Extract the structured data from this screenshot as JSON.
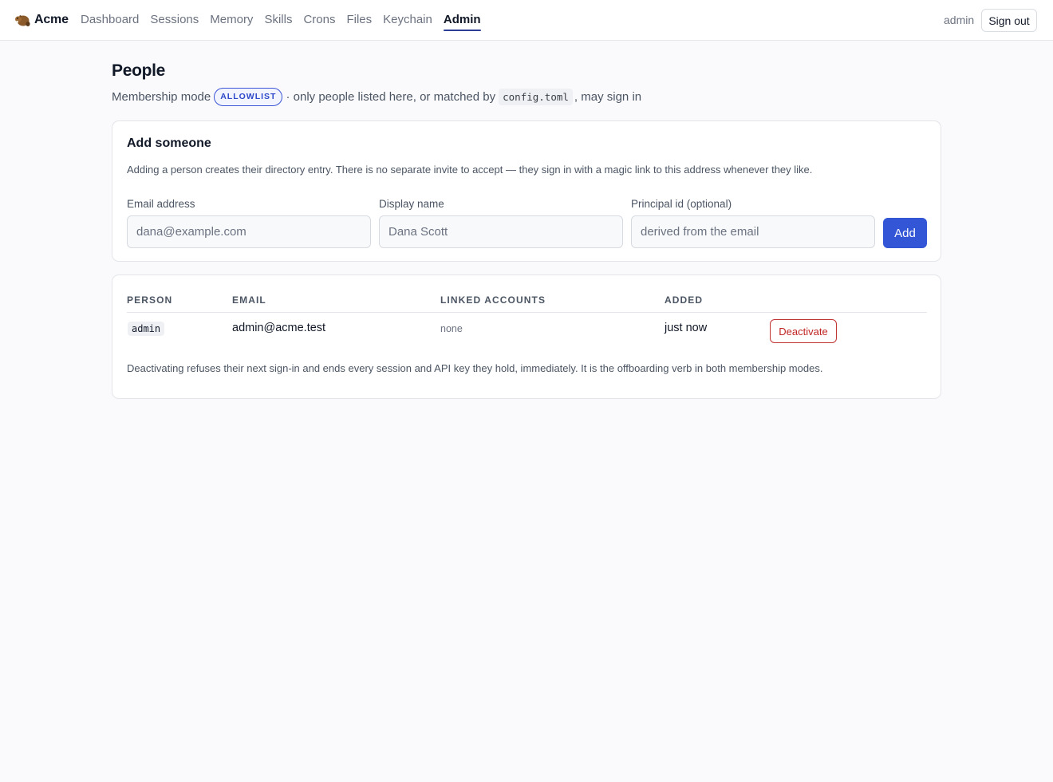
{
  "brand": {
    "name": "Acme",
    "logo_icon": "beaver-icon"
  },
  "nav": {
    "items": [
      {
        "label": "Dashboard",
        "active": false
      },
      {
        "label": "Sessions",
        "active": false
      },
      {
        "label": "Memory",
        "active": false
      },
      {
        "label": "Skills",
        "active": false
      },
      {
        "label": "Crons",
        "active": false
      },
      {
        "label": "Files",
        "active": false
      },
      {
        "label": "Keychain",
        "active": false
      },
      {
        "label": "Admin",
        "active": true
      }
    ],
    "accent_color": "#2c3e95"
  },
  "user": {
    "name": "admin",
    "signout_label": "Sign out"
  },
  "page": {
    "title": "People",
    "mode_prefix": "Membership mode",
    "mode_badge": "ALLOWLIST",
    "mode_middle": "· only people listed here, or matched by",
    "config_file": "config.toml",
    "mode_suffix": ", may sign in"
  },
  "add_card": {
    "title": "Add someone",
    "description": "Adding a person creates their directory entry. There is no separate invite to accept — they sign in with a magic link to this address whenever they like.",
    "fields": [
      {
        "label": "Email address",
        "placeholder": "dana@example.com",
        "value": ""
      },
      {
        "label": "Display name",
        "placeholder": "Dana Scott",
        "value": ""
      },
      {
        "label": "Principal id (optional)",
        "placeholder": "derived from the email",
        "value": ""
      }
    ],
    "add_label": "Add",
    "primary_color": "#3356d6"
  },
  "people_table": {
    "headers": [
      "Person",
      "Email",
      "Linked accounts",
      "Added"
    ],
    "rows": [
      {
        "person": "admin",
        "email": "admin@acme.test",
        "linked_accounts": "none",
        "added": "just now",
        "action_label": "Deactivate"
      }
    ],
    "danger_color": "#c02424",
    "note": "Deactivating refuses their next sign-in and ends every session and API key they hold, immediately. It is the offboarding verb in both membership modes."
  }
}
